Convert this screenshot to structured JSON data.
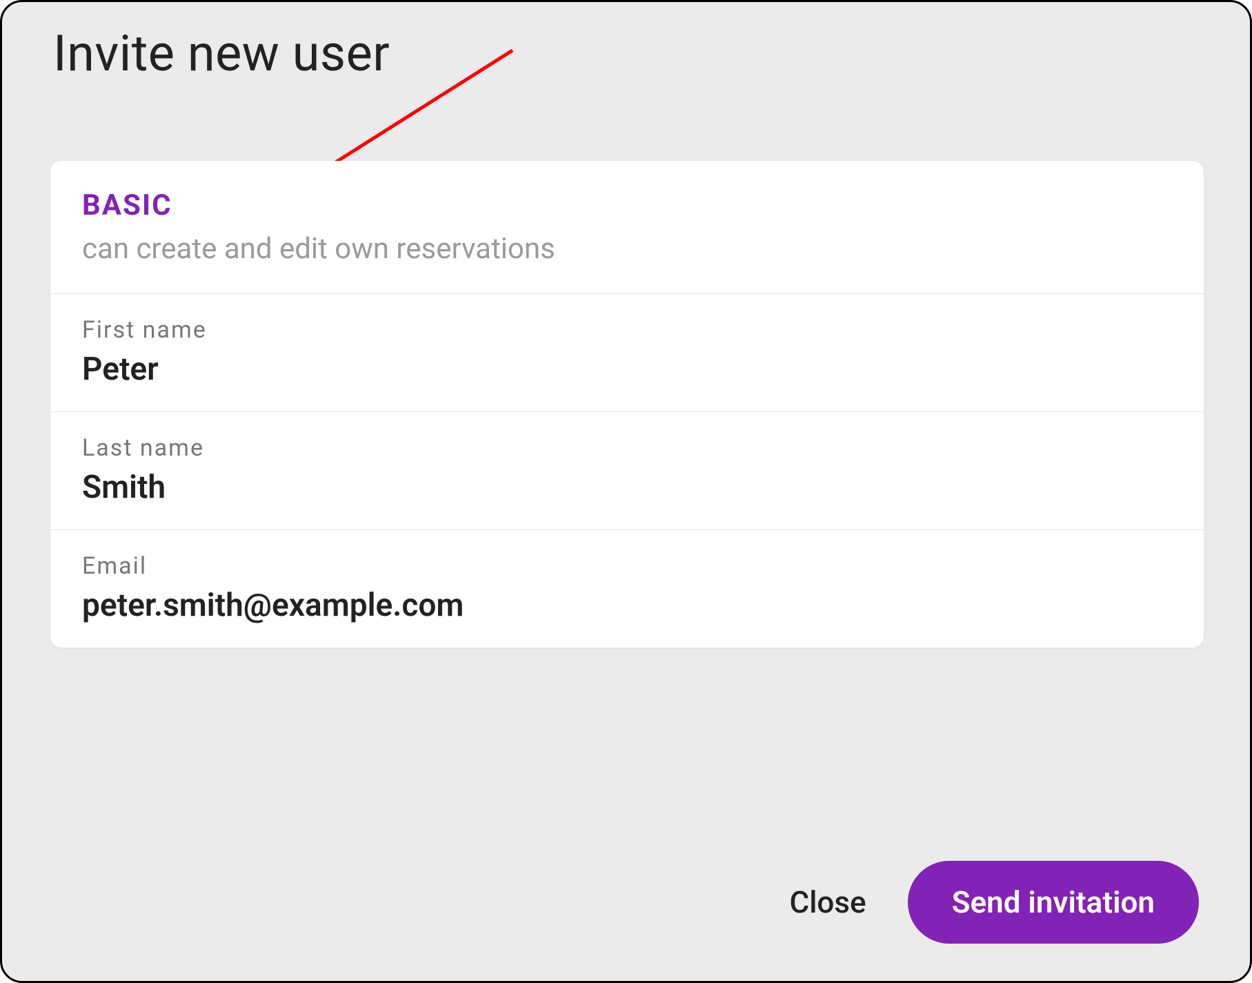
{
  "dialog": {
    "title": "Invite new user",
    "role": {
      "name": "BASIC",
      "description": "can create and edit own reservations"
    },
    "fields": {
      "first_name": {
        "label": "First name",
        "value": "Peter"
      },
      "last_name": {
        "label": "Last name",
        "value": "Smith"
      },
      "email": {
        "label": "Email",
        "value": "peter.smith@example.com"
      }
    },
    "actions": {
      "close_label": "Close",
      "send_label": "Send invitation"
    }
  },
  "colors": {
    "accent": "#8322b6",
    "annotation": "#ff0000"
  }
}
